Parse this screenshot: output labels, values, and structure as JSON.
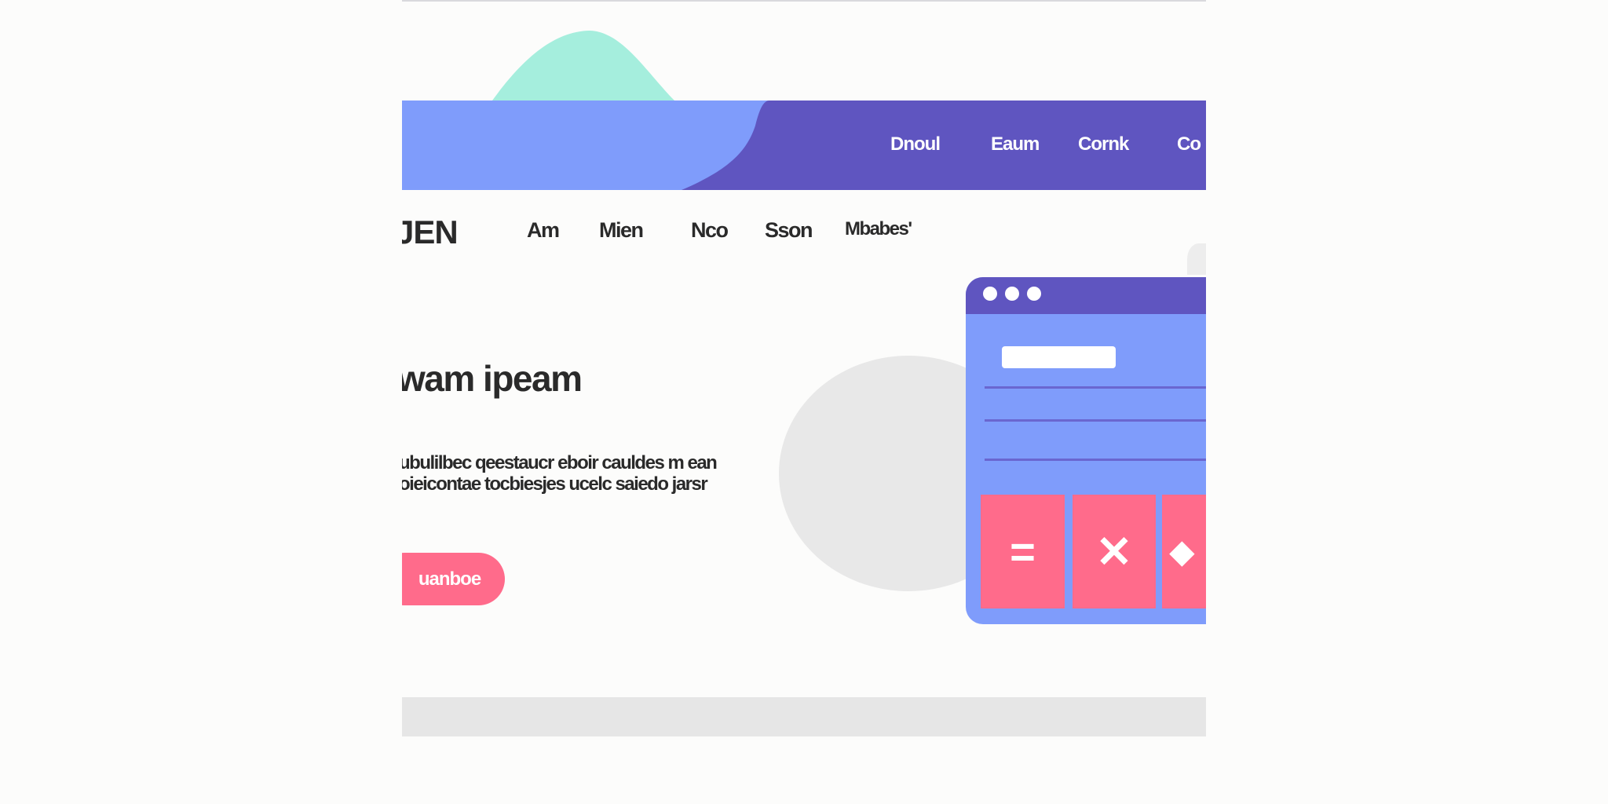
{
  "colors": {
    "background": "#fcfcfb",
    "band_light": "#7f9cfb",
    "band_dark": "#5f55c0",
    "hill": "#a5eedd",
    "accent": "#ff6b8b",
    "ellipse": "#e8e8e8"
  },
  "header": {
    "links": [
      "Dnoul",
      "Eaum",
      "Cornk",
      "Co"
    ]
  },
  "nav": {
    "logo": "JEN",
    "items": [
      "Am",
      "Mien",
      "Nco",
      "Sson",
      "Mbabes'"
    ]
  },
  "hero": {
    "headline": "wam ipeam",
    "paragraph": "ubulilbec qeestaucr eboir cauldes m ean oieicontae tocbiesjes ucelc saiedo jarsr",
    "cta_label": "uanboe"
  },
  "card": {
    "tiles": [
      {
        "icon": "equals-icon",
        "glyph": "="
      },
      {
        "icon": "close-icon",
        "glyph": "✕"
      },
      {
        "icon": "diamond-icon",
        "glyph": "◆"
      }
    ]
  }
}
